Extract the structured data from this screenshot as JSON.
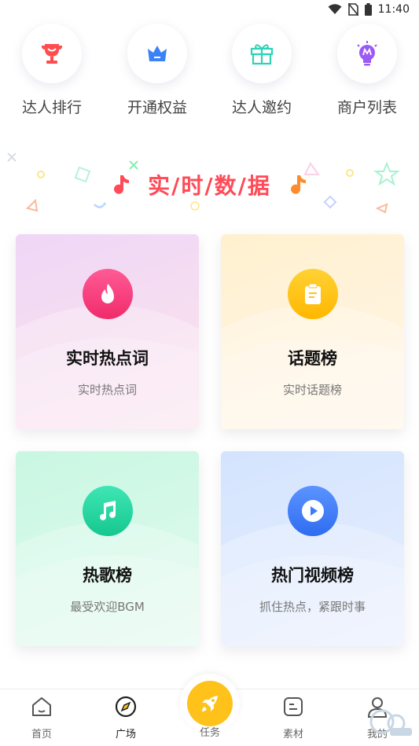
{
  "status_bar": {
    "time": "11:40"
  },
  "quick_entries": [
    {
      "label": "达人排行",
      "icon": "trophy-icon",
      "color": "#ff4d4f"
    },
    {
      "label": "开通权益",
      "icon": "crown-icon",
      "color": "#3b82f6"
    },
    {
      "label": "达人邀约",
      "icon": "gift-icon",
      "color": "#2ed3b7"
    },
    {
      "label": "商户列表",
      "icon": "lightbulb-icon",
      "color": "#9b59f6"
    }
  ],
  "banner": {
    "title": "实/时/数/据",
    "accent_color": "#ff4a57"
  },
  "cards": [
    {
      "title": "实时热点词",
      "subtitle": "实时热点词",
      "icon": "flame-icon",
      "icon_color": "#ff3f7e"
    },
    {
      "title": "话题榜",
      "subtitle": "实时话题榜",
      "icon": "clipboard-icon",
      "icon_color": "#ffc21a"
    },
    {
      "title": "热歌榜",
      "subtitle": "最受欢迎BGM",
      "icon": "music-note-icon",
      "icon_color": "#22d3a1"
    },
    {
      "title": "热门视频榜",
      "subtitle": "抓住热点，紧跟时事",
      "icon": "play-icon",
      "icon_color": "#3d7cf5"
    }
  ],
  "bottom_nav": {
    "items": [
      {
        "label": "首页",
        "icon": "home-icon"
      },
      {
        "label": "广场",
        "icon": "compass-icon",
        "active": true
      },
      {
        "label": "任务",
        "icon": "rocket-icon"
      },
      {
        "label": "素材",
        "icon": "material-icon"
      },
      {
        "label": "我的",
        "icon": "user-icon"
      }
    ]
  }
}
